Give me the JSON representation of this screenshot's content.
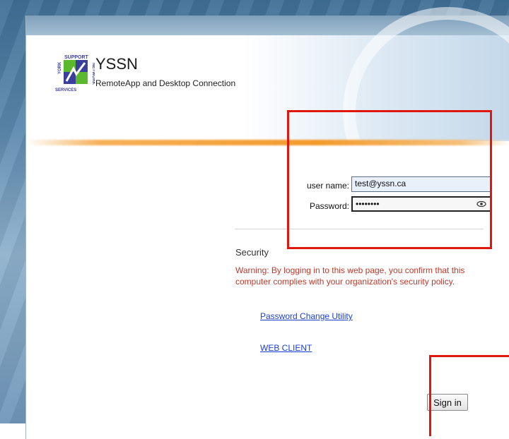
{
  "brand": {
    "name": "YSSN",
    "subtitle": "RemoteApp and Desktop Connection"
  },
  "logo": {
    "icon": "yssn-logo-icon",
    "text": [
      "YORK",
      "SUPPORT",
      "SERVICES",
      "NETWORK"
    ]
  },
  "form": {
    "username_label": "user name:",
    "username_value": "test@yssn.ca",
    "password_label": "Password:",
    "password_value": "••••••••",
    "reveal_icon": "eye-icon"
  },
  "security": {
    "title": "Security",
    "warning": "Warning: By logging in to this web page, you confirm that this computer complies with your organization's security policy."
  },
  "links": {
    "password_change": "Password Change Utility",
    "web_client": "WEB CLIENT"
  },
  "actions": {
    "signin_label": "Sign in"
  },
  "colors": {
    "warning": "#c0392b",
    "link": "#1a3fd1",
    "accent_line": "#f39a2a",
    "highlight_box": "#e0170f"
  }
}
